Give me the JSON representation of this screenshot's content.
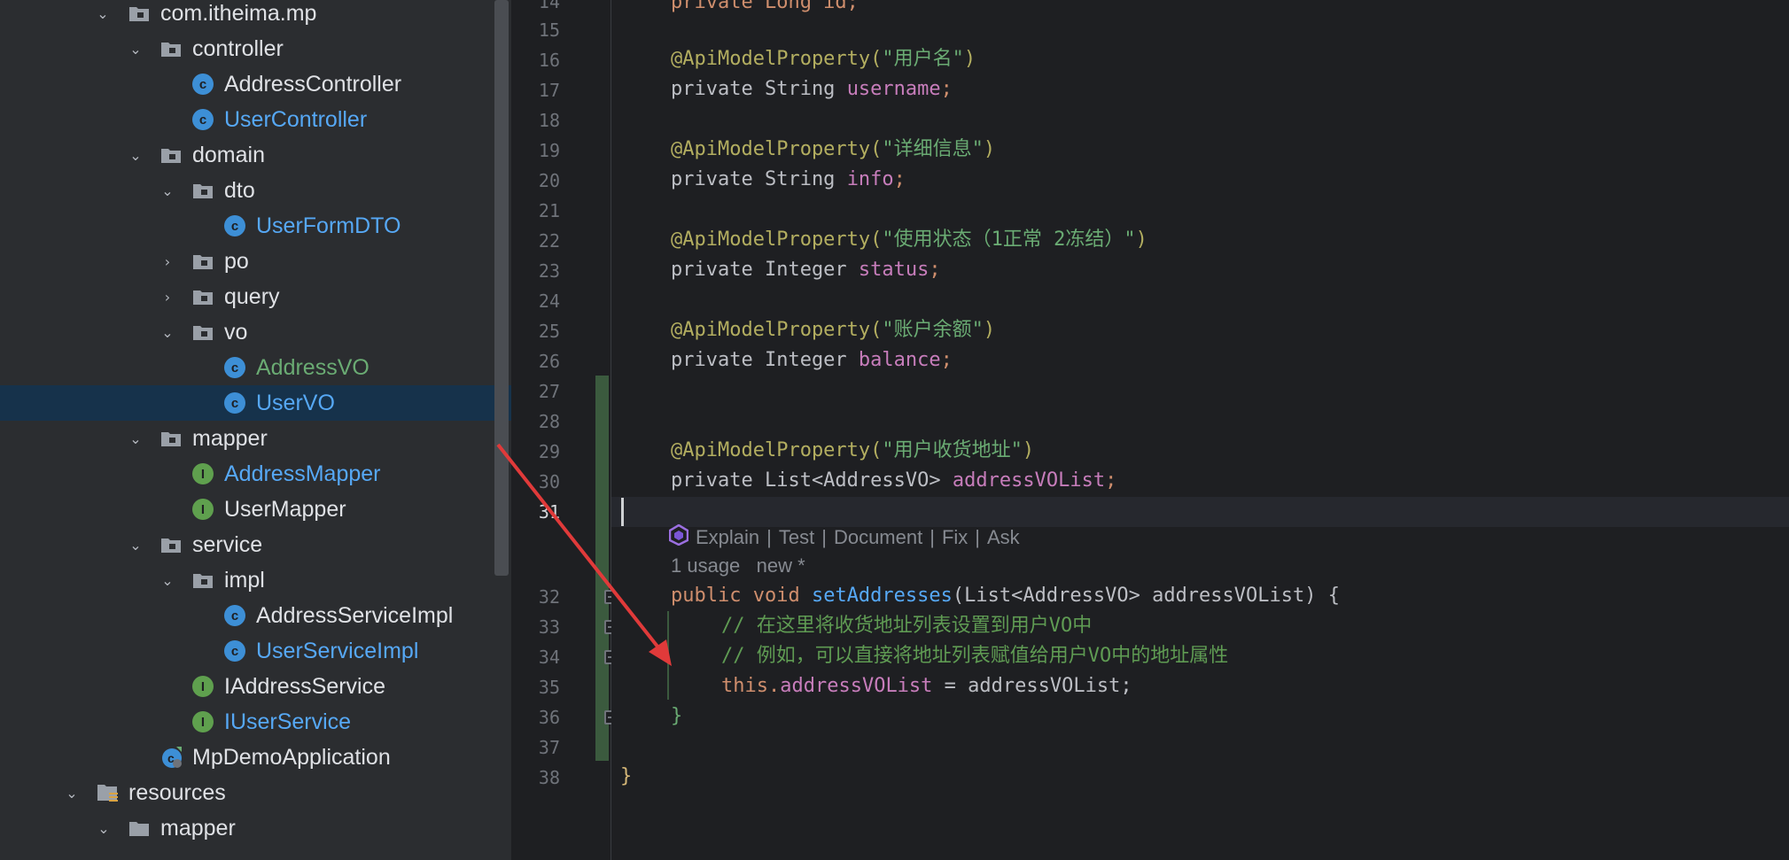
{
  "project_tree": {
    "items": [
      {
        "label": "com.itheima.mp",
        "type": "package",
        "expanded": true,
        "color": "default"
      },
      {
        "label": "controller",
        "type": "package",
        "expanded": true,
        "color": "default"
      },
      {
        "label": "AddressController",
        "type": "class",
        "color": "default"
      },
      {
        "label": "UserController",
        "type": "class",
        "color": "blue"
      },
      {
        "label": "domain",
        "type": "package",
        "expanded": true,
        "color": "default"
      },
      {
        "label": "dto",
        "type": "package",
        "expanded": true,
        "color": "default"
      },
      {
        "label": "UserFormDTO",
        "type": "class",
        "color": "blue"
      },
      {
        "label": "po",
        "type": "package",
        "expanded": false,
        "color": "default"
      },
      {
        "label": "query",
        "type": "package",
        "expanded": false,
        "color": "default"
      },
      {
        "label": "vo",
        "type": "package",
        "expanded": true,
        "color": "default"
      },
      {
        "label": "AddressVO",
        "type": "class",
        "color": "green"
      },
      {
        "label": "UserVO",
        "type": "class",
        "color": "blue",
        "selected": true
      },
      {
        "label": "mapper",
        "type": "package",
        "expanded": true,
        "color": "default"
      },
      {
        "label": "AddressMapper",
        "type": "interface",
        "color": "blue"
      },
      {
        "label": "UserMapper",
        "type": "interface",
        "color": "default"
      },
      {
        "label": "service",
        "type": "package",
        "expanded": true,
        "color": "default"
      },
      {
        "label": "impl",
        "type": "package",
        "expanded": true,
        "color": "default"
      },
      {
        "label": "AddressServiceImpl",
        "type": "class",
        "color": "default"
      },
      {
        "label": "UserServiceImpl",
        "type": "class",
        "color": "blue"
      },
      {
        "label": "IAddressService",
        "type": "interface",
        "color": "default"
      },
      {
        "label": "IUserService",
        "type": "interface",
        "color": "blue"
      },
      {
        "label": "MpDemoApplication",
        "type": "spring-class",
        "color": "default"
      },
      {
        "label": "resources",
        "type": "resources-folder",
        "expanded": true,
        "color": "default"
      },
      {
        "label": "mapper",
        "type": "folder",
        "expanded": true,
        "color": "default"
      }
    ]
  },
  "gutter": {
    "line_numbers": [
      "14",
      "15",
      "16",
      "17",
      "18",
      "19",
      "20",
      "21",
      "22",
      "23",
      "24",
      "25",
      "26",
      "27",
      "28",
      "29",
      "30",
      "31",
      "32",
      "33",
      "34",
      "35",
      "36",
      "37",
      "38"
    ],
    "current_line": "31"
  },
  "editor": {
    "code_lines": {
      "l14": "private Long id;",
      "l16_ann": "@ApiModelProperty(",
      "l16_str": "\"用户名\"",
      "l17_type": "private String ",
      "l17_field": "username",
      "l19_str": "\"详细信息\"",
      "l20_type": "private String ",
      "l20_field": "info",
      "l22_str": "\"使用状态（1正常 2冻结）\"",
      "l23_type": "private Integer ",
      "l23_field": "status",
      "l25_str": "\"账户余额\"",
      "l26_type": "private Integer ",
      "l26_field": "balance",
      "l29_str": "\"用户收货地址\"",
      "l30_type": "private List<AddressVO> ",
      "l30_field": "addressVOList",
      "l32_sig_pre": "public void ",
      "l32_name": "setAddresses",
      "l32_params": "(List<AddressVO> addressVOList) {",
      "l33_comment": "// 在这里将收货地址列表设置到用户VO中",
      "l34_comment": "// 例如，可以直接将地址列表赋值给用户VO中的地址属性",
      "l35_this": "this.",
      "l35_field": "addressVOList",
      "l35_rest": " = addressVOList;",
      "l36": "}",
      "l38": "}",
      "close_paren": ")",
      "semicolon": ";"
    },
    "ai_actions": {
      "explain": "Explain",
      "test": "Test",
      "document": "Document",
      "fix": "Fix",
      "ask": "Ask",
      "separator": "|"
    },
    "usage_hint": "1 usage",
    "new_hint": "new *"
  },
  "colors": {
    "keyword": "#cf8e6d",
    "annotation": "#b3ae60",
    "string": "#6aab73",
    "field": "#c77dbb",
    "method": "#56a8f5",
    "selection": "#16324b",
    "arrow": "#e03a3a"
  }
}
